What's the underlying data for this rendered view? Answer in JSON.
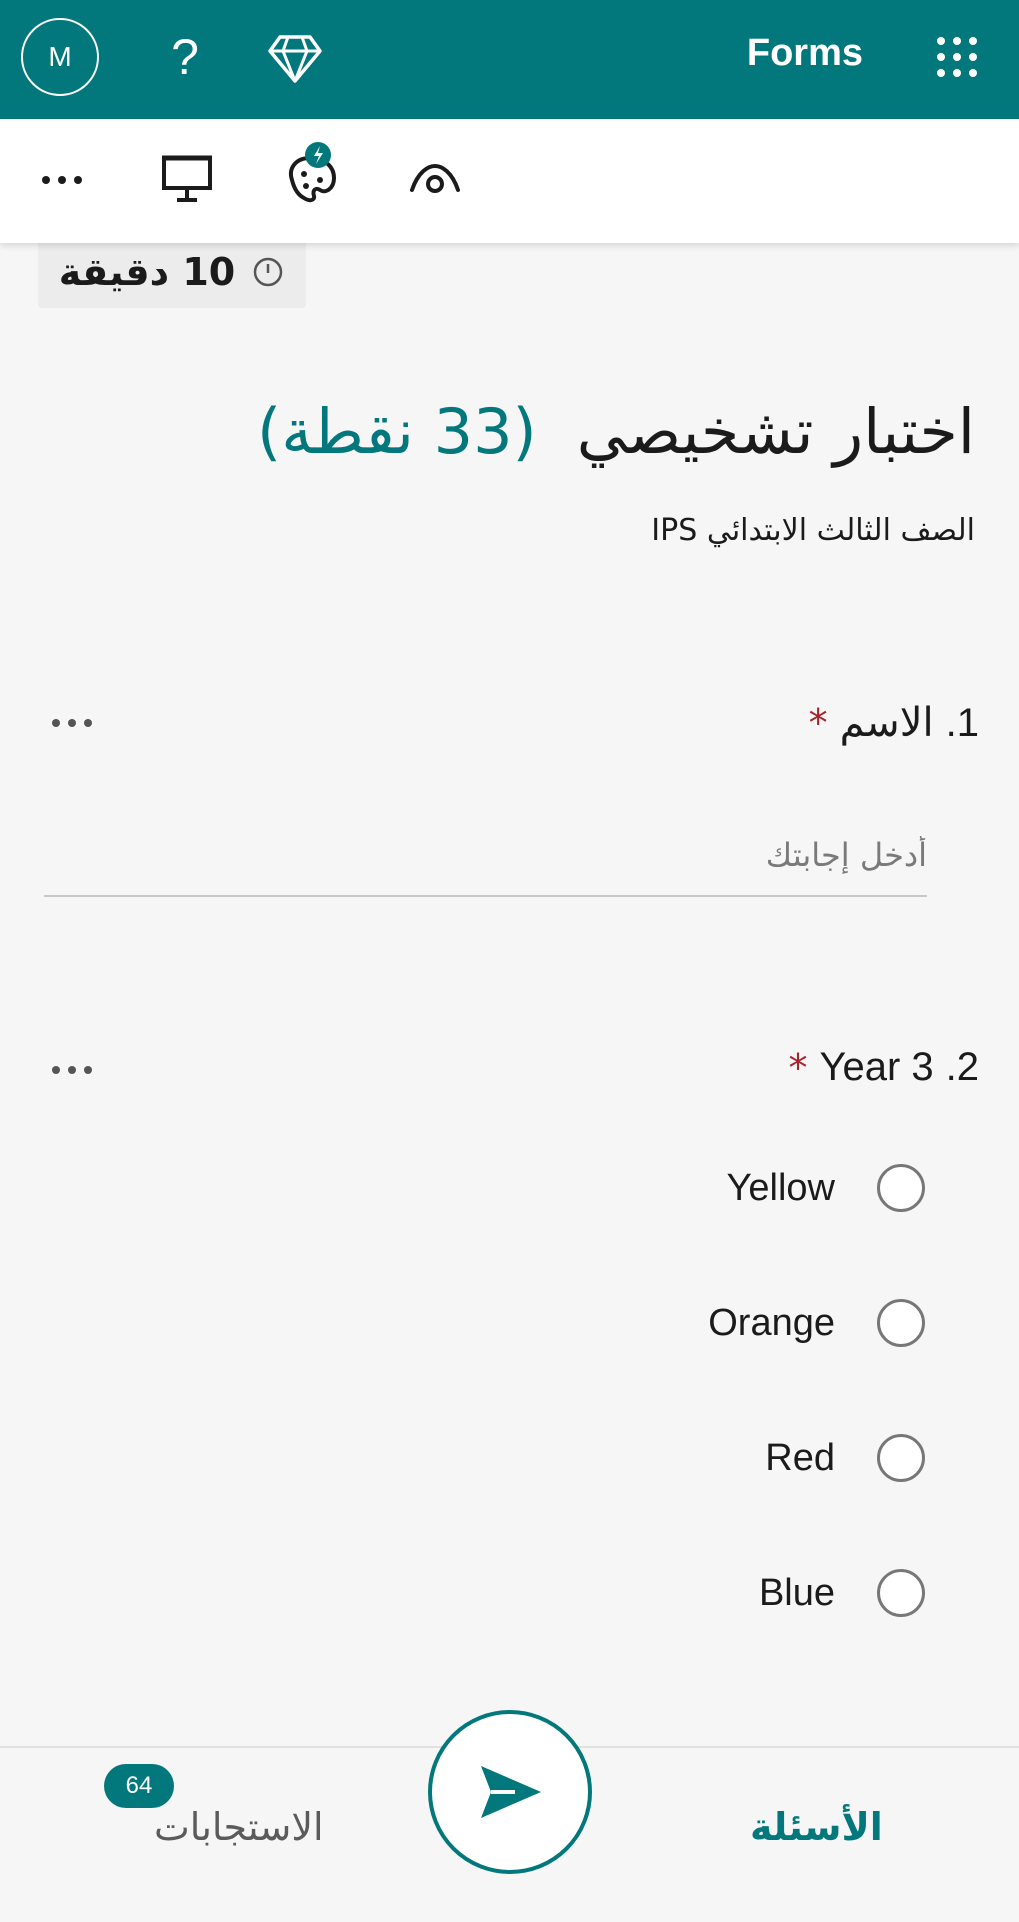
{
  "header": {
    "avatar_initial": "M",
    "help_glyph": "?",
    "app_name": "Forms",
    "icons": [
      "help-icon",
      "diamond-icon",
      "app-launcher-icon"
    ]
  },
  "toolbar": {
    "icons": [
      "more-icon",
      "present-icon",
      "theme-palette-icon",
      "preview-eye-icon"
    ]
  },
  "timer": {
    "value": "10 دقيقة",
    "icon": "clock-icon"
  },
  "form": {
    "title": "اختبار تشخيصي",
    "points": "(33 نقطة)",
    "subtitle": "الصف الثالث الابتدائي IPS"
  },
  "questions": [
    {
      "number": "1.",
      "text": "الاسم",
      "required_mark": "*",
      "placeholder": "أدخل إجابتك"
    },
    {
      "number": "2.",
      "text": "Year 3",
      "required_mark": "*",
      "options": [
        "Yellow",
        "Orange",
        "Red",
        "Blue"
      ]
    }
  ],
  "bottom_nav": {
    "responses_label": "الاستجابات",
    "responses_count": "64",
    "questions_label": "الأسئلة",
    "send_icon": "send-icon"
  },
  "colors": {
    "brand": "#03787c",
    "required": "#a4262c"
  }
}
